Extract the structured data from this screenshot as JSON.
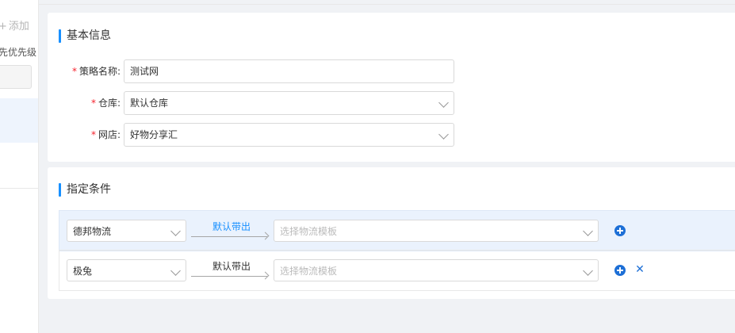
{
  "sidebar": {
    "add_label": "添加",
    "add_icon": "plus-icon",
    "priority_label": "先优先级"
  },
  "basic_info": {
    "title": "基本信息",
    "fields": [
      {
        "label": "策略名称:",
        "value": "测试网",
        "required": true,
        "type": "text"
      },
      {
        "label": "仓库:",
        "value": "默认仓库",
        "required": true,
        "type": "select"
      },
      {
        "label": "网店:",
        "value": "好物分享汇",
        "required": true,
        "type": "select"
      }
    ]
  },
  "conditions": {
    "title": "指定条件",
    "rows": [
      {
        "carrier": "德邦物流",
        "arrow_label": "默认带出",
        "template_placeholder": "选择物流模板",
        "active": true,
        "show_delete": false
      },
      {
        "carrier": "极兔",
        "arrow_label": "默认带出",
        "template_placeholder": "选择物流模板",
        "active": false,
        "show_delete": true
      }
    ]
  },
  "colors": {
    "accent": "#1890ff",
    "icon_blue": "#1d6fd6",
    "required": "#f5222d",
    "active_row": "#eaf2fd"
  }
}
